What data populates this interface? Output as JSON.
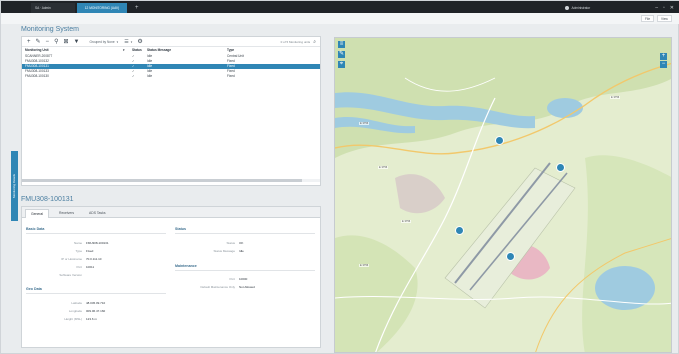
{
  "window": {
    "tabs": [
      {
        "label": "SA · Admin"
      },
      {
        "label": "12 MONITORING (UAV)"
      },
      {
        "label": "+ ▾"
      }
    ],
    "user": "Administrator",
    "controls": [
      "–",
      "▫",
      "✕"
    ]
  },
  "menu": {
    "file": "File",
    "view": "View"
  },
  "monitoring": {
    "title": "Monitoring System",
    "toolbar": {
      "grouped_by": "Grouped by None",
      "search_placeholder": "0 of 5 Monitoring units"
    },
    "columns": [
      "Monitoring Unit",
      "Status",
      "Status Message",
      "Type"
    ],
    "rows": [
      {
        "unit": "SCANNER-200877",
        "status": "✓",
        "message": "Idle",
        "type": "Central Unit"
      },
      {
        "unit": "FMU308-100132",
        "status": "✓",
        "message": "Idle",
        "type": "Fixed"
      },
      {
        "unit": "FMU308-100131",
        "status": "✓",
        "message": "Idle",
        "type": "Fixed"
      },
      {
        "unit": "FMU308-100133",
        "status": "✓",
        "message": "Idle",
        "type": "Fixed"
      },
      {
        "unit": "FMU308-100130",
        "status": "✓",
        "message": "Idle",
        "type": "Fixed"
      }
    ],
    "selected_index": 2
  },
  "side_tab": "Monitoring Details",
  "detail": {
    "title": "FMU308-100131",
    "tabs": [
      "General",
      "Receivers",
      "ADS Tasks"
    ],
    "basic_data": {
      "heading": "Basic Data",
      "fields": [
        {
          "label": "Name",
          "value": "FMU308-100131"
        },
        {
          "label": "Type",
          "value": "Fixed"
        },
        {
          "label": "IP or Hostname",
          "value": "70.0.111.10"
        },
        {
          "label": "Port",
          "value": "10011"
        },
        {
          "label": "Software Version",
          "value": ""
        }
      ]
    },
    "geo_data": {
      "heading": "Geo Data",
      "fields": [
        {
          "label": "Latitude",
          "value": "48.045.09.710"
        },
        {
          "label": "Longitude",
          "value": "009.06.47.160"
        },
        {
          "label": "Height (MSL)",
          "value": "123.6 m"
        }
      ]
    },
    "status": {
      "heading": "Status",
      "fields": [
        {
          "label": "Status",
          "value": "OK"
        },
        {
          "label": "Status Message",
          "value": "Idle"
        }
      ]
    },
    "maintenance": {
      "heading": "Maintenance",
      "fields": [
        {
          "label": "Port",
          "value": "10000"
        },
        {
          "label": "Default Maintenance Only",
          "value": "Not Allowed"
        }
      ]
    }
  },
  "map": {
    "road_labels": [
      "E 3756",
      "E 3756",
      "E 3756",
      "E 3756",
      "E 3756"
    ],
    "marker_count": 4,
    "zoom_in": "+",
    "zoom_out": "−"
  },
  "colors": {
    "accent": "#2f86b5",
    "title_bar": "#1f2327",
    "map_land": "#e4edcf",
    "map_water": "#9fcbe0"
  }
}
